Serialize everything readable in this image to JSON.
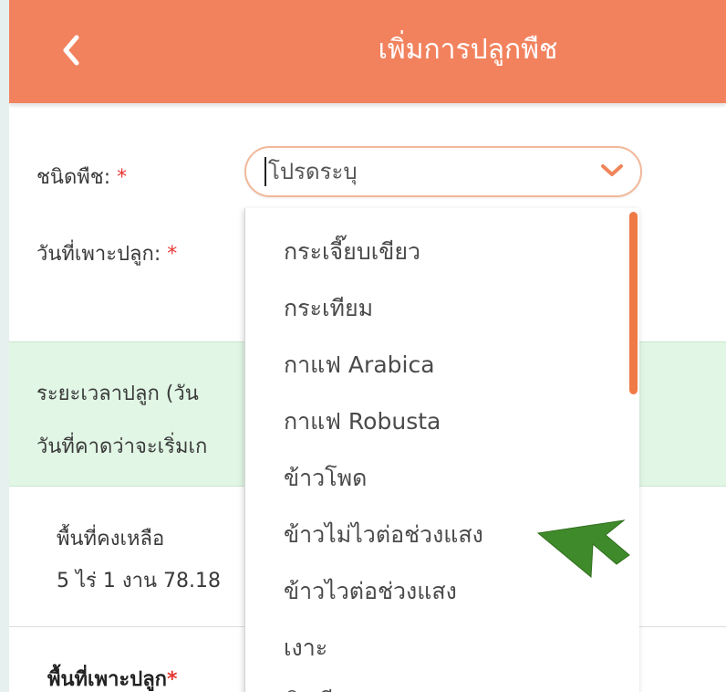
{
  "header": {
    "title": "เพิ่มการปลูกพืช",
    "back_icon": "chevron-left-icon",
    "background_color": "#f2825e"
  },
  "form": {
    "crop_type_label": "ชนิดพืช:",
    "crop_date_label": "วันที่เพาะปลูก:",
    "required_mark": "*",
    "select_value": "โปรดระบุ",
    "select_icon": "chevron-down-icon"
  },
  "info": {
    "duration_label": "ระยะเวลาปลูก (วัน",
    "harvest_label": "วันที่คาดว่าจะเริ่มเก",
    "background_color": "#e1f6e5"
  },
  "remaining": {
    "label": "พื้นที่คงเหลือ",
    "value": "5 ไร่ 1 งาน 78.18"
  },
  "planting_area": {
    "label": "พื้นที่เพาะปลูก",
    "required_mark": "*"
  },
  "dropdown": {
    "options": [
      "กระเจี๊ยบเขียว",
      "กระเทียม",
      "กาแฟ Arabica",
      "กาแฟ Robusta",
      "ข้าวโพด",
      "ข้าวไม่ไวต่อช่วงแสง",
      "ข้าวไวต่อช่วงแสง",
      "เงาะ",
      "ขิงเทียม"
    ],
    "scrollbar_color": "#ef7a46"
  },
  "annotation": {
    "icon": "arrow-pointer-icon",
    "color": "#3f8a2a"
  }
}
